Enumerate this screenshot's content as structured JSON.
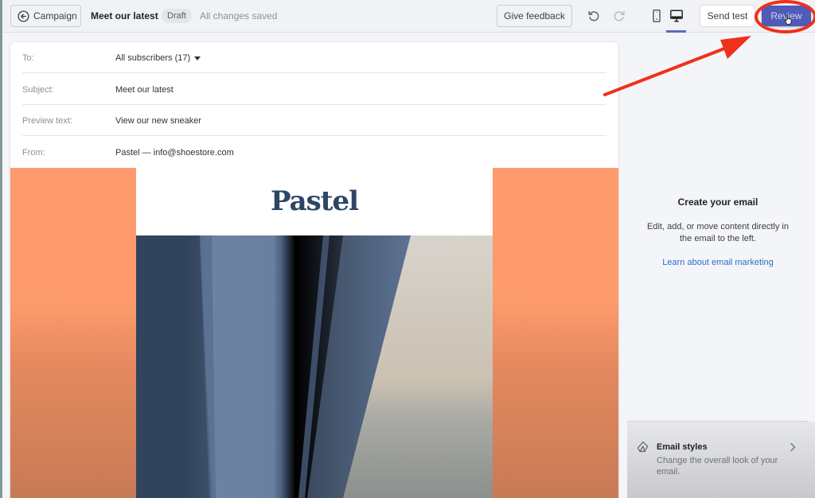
{
  "topbar": {
    "back_label": "Campaign",
    "title": "Meet our latest",
    "status_badge": "Draft",
    "save_status": "All changes saved",
    "feedback_label": "Give feedback",
    "send_test_label": "Send test",
    "review_label": "Review",
    "active_device": "desktop"
  },
  "email_fields": [
    {
      "label": "To:",
      "value": "All subscribers (17)"
    },
    {
      "label": "Subject:",
      "value": "Meet our latest"
    },
    {
      "label": "Preview text:",
      "value": "View our new sneaker"
    },
    {
      "label": "From:",
      "value": "Pastel — info@shoestore.com"
    }
  ],
  "email_content": {
    "logo_text": "Pastel",
    "background_color": "#fd9b6c"
  },
  "right_panel": {
    "title": "Create your email",
    "description": "Edit, add, or move content directly in the email to the left.",
    "link": "Learn about email marketing",
    "styles": {
      "title": "Email styles",
      "description": "Change the overall look of your email."
    }
  },
  "colors": {
    "primary": "#4f5bb7",
    "annotation": "#f0301a",
    "link": "#2c6ecb"
  }
}
